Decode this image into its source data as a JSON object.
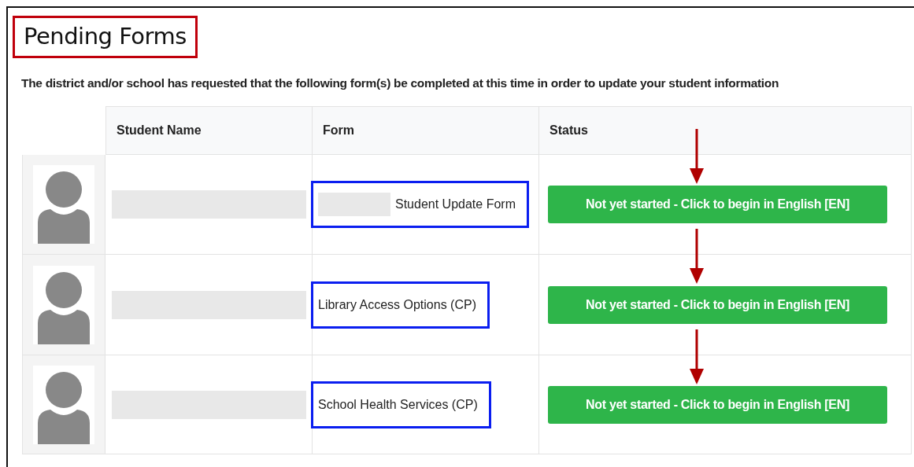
{
  "title": "Pending Forms",
  "description": "The district and/or school has requested that the following form(s) be completed at this time in order to update your student information",
  "columns": [
    "Student Name",
    "Form",
    "Status"
  ],
  "rows": [
    {
      "form": "Student Update Form",
      "form_redacted_prefix": true,
      "status": "Not yet started - Click to begin in English [EN]"
    },
    {
      "form": "Library Access Options (CP)",
      "form_redacted_prefix": false,
      "status": "Not yet started - Click to begin in English [EN]"
    },
    {
      "form": "School Health Services (CP)",
      "form_redacted_prefix": false,
      "status": "Not yet started - Click to begin in English [EN]"
    }
  ]
}
